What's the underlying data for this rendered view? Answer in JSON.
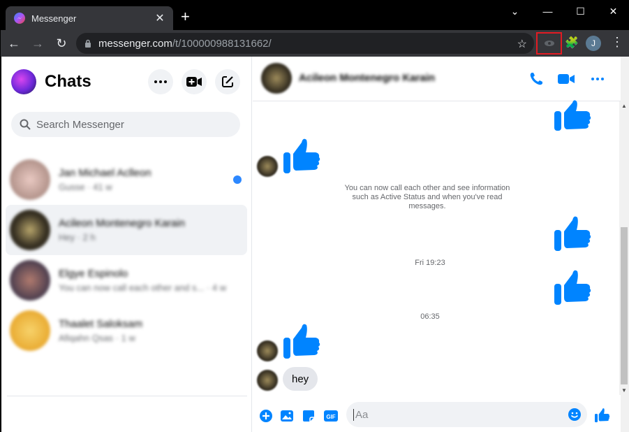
{
  "browser": {
    "tab_title": "Messenger",
    "url_host": "messenger.com",
    "url_path": "/t/100000988131662/",
    "profile_initial": "J"
  },
  "sidebar": {
    "title": "Chats",
    "search_placeholder": "Search Messenger",
    "chats": [
      {
        "name": "Jan Michael Aclleon",
        "preview": "Gusse · 41 w",
        "unread": true,
        "avatar_colors": [
          "#e9c9c2",
          "#9a7b72"
        ]
      },
      {
        "name": "Acileon Montenegro Karain",
        "preview": "Hey · 2 h",
        "unread": false,
        "active": true,
        "avatar_colors": [
          "#b5a36a",
          "#1a1712"
        ]
      },
      {
        "name": "Elgye Espinolo",
        "preview": "You can now call each other and s... · 4 w",
        "unread": false,
        "avatar_colors": [
          "#b07a6e",
          "#1f2340"
        ]
      },
      {
        "name": "Thaalet Saloksam",
        "preview": "Afiqahn Qsas · 1 w",
        "unread": false,
        "avatar_colors": [
          "#f7c64a",
          "#e39a1a"
        ]
      }
    ]
  },
  "conversation": {
    "contact_name": "Acileon Montenegro Karain",
    "system_message": "You can now call each other and see information such as Active Status and when you've read messages.",
    "timestamps": [
      "Fri 19:23",
      "06:35"
    ],
    "last_message": "hey",
    "input_placeholder": "Aa"
  },
  "colors": {
    "accent": "#0084ff",
    "bubble_bg": "#e4e6eb",
    "highlight_border": "#e31b23"
  }
}
